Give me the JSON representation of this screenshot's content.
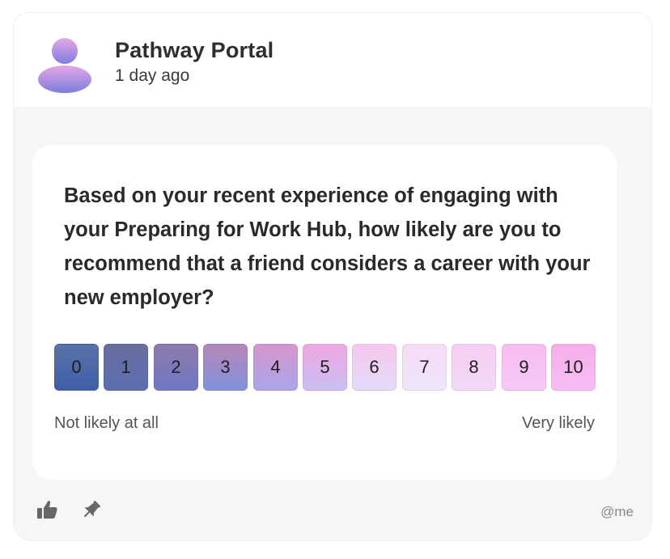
{
  "post": {
    "author": "Pathway Portal",
    "time": "1 day ago",
    "avatar_icon": "user-avatar-icon"
  },
  "survey": {
    "question": "Based on your recent experience of engaging with your Preparing for Work Hub, how likely are you to recommend that a friend considers a career with your new employer?",
    "scale": [
      {
        "label": "0",
        "color_top": "#5a73a7",
        "color_bottom": "#3f5ea8"
      },
      {
        "label": "1",
        "color_top": "#6a6f9e",
        "color_bottom": "#5b6db0"
      },
      {
        "label": "2",
        "color_top": "#8f7bab",
        "color_bottom": "#6d78c4"
      },
      {
        "label": "3",
        "color_top": "#b886b8",
        "color_bottom": "#8192dc"
      },
      {
        "label": "4",
        "color_top": "#d796cc",
        "color_bottom": "#a9a5ea"
      },
      {
        "label": "5",
        "color_top": "#f0a6e0",
        "color_bottom": "#c8c0f2"
      },
      {
        "label": "6",
        "color_top": "#f7c7ee",
        "color_bottom": "#e2dbfa"
      },
      {
        "label": "7",
        "color_top": "#f7dbf5",
        "color_bottom": "#ede6fb"
      },
      {
        "label": "8",
        "color_top": "#f7cdf3",
        "color_bottom": "#f2d9f8"
      },
      {
        "label": "9",
        "color_top": "#f8bdf0",
        "color_bottom": "#f5c9f5"
      },
      {
        "label": "10",
        "color_top": "#f6aeeb",
        "color_bottom": "#f7bdf2"
      }
    ],
    "label_low": "Not likely at all",
    "label_high": "Very likely"
  },
  "footer": {
    "like_icon": "thumbs-up-icon",
    "pin_icon": "pin-icon",
    "mention": "@me"
  }
}
